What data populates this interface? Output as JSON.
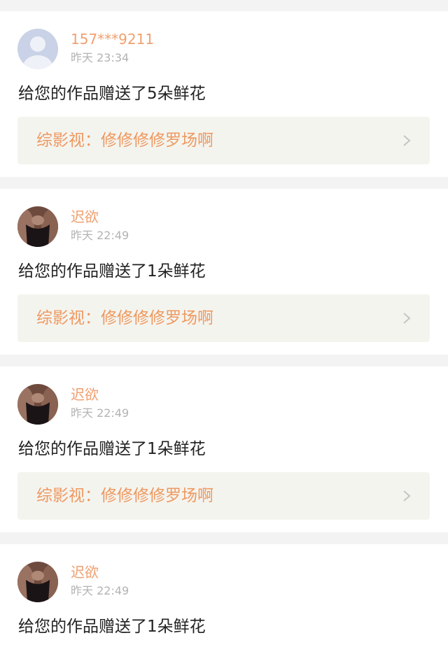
{
  "colors": {
    "page_background": "#f3f3f3",
    "card_background": "#ffffff",
    "username": "#f0a070",
    "timestamp": "#b3b3b3",
    "message_text": "#222222",
    "link_background": "#f4f4ef",
    "link_text": "#ee9960",
    "chevron": "#c4c4c4"
  },
  "notifications": [
    {
      "avatar": "default-user-avatar",
      "username": "157***9211",
      "time": "昨天 23:34",
      "message": "给您的作品赠送了5朵鲜花",
      "work_title": "综影视：修修修修罗场啊",
      "chevron": "chevron-right-icon"
    },
    {
      "avatar": "user-photo-avatar",
      "username": "迟欲",
      "time": "昨天 22:49",
      "message": "给您的作品赠送了1朵鲜花",
      "work_title": "综影视：修修修修罗场啊",
      "chevron": "chevron-right-icon"
    },
    {
      "avatar": "user-photo-avatar",
      "username": "迟欲",
      "time": "昨天 22:49",
      "message": "给您的作品赠送了1朵鲜花",
      "work_title": "综影视：修修修修罗场啊",
      "chevron": "chevron-right-icon"
    },
    {
      "avatar": "user-photo-avatar",
      "username": "迟欲",
      "time": "昨天 22:49",
      "message": "给您的作品赠送了1朵鲜花",
      "work_title": "",
      "chevron": ""
    }
  ]
}
